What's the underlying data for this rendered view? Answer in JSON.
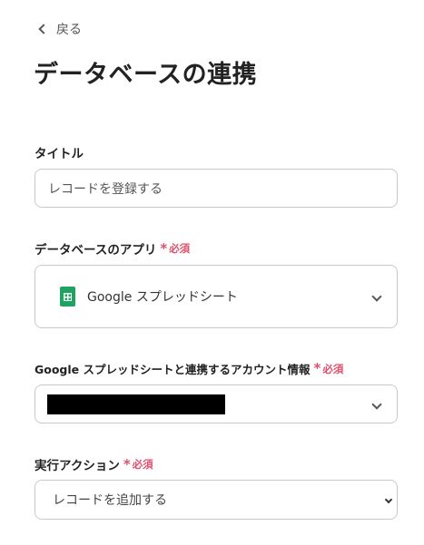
{
  "nav": {
    "back_label": "戻る"
  },
  "page": {
    "title": "データベースの連携"
  },
  "fields": {
    "title": {
      "label": "タイトル",
      "value": "レコードを登録する"
    },
    "app": {
      "label": "データベースのアプリ",
      "required": "必須",
      "value": "Google スプレッドシート",
      "icon": "google-sheets-icon"
    },
    "account": {
      "label": "Google スプレッドシートと連携するアカウント情報",
      "required": "必須"
    },
    "action": {
      "label": "実行アクション",
      "required": "必須",
      "value": "レコードを追加する"
    }
  },
  "colors": {
    "required": "#e0506e",
    "sheets_green": "#1ea362"
  }
}
